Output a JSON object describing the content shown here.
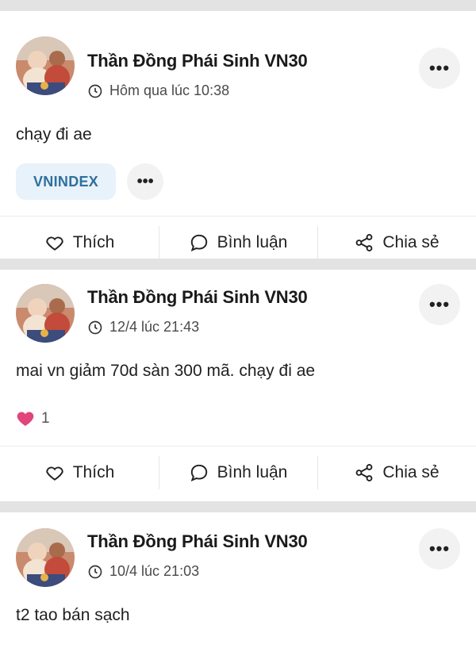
{
  "posts": [
    {
      "author": "Thần Đồng Phái Sinh VN30",
      "time": "Hôm qua lúc 10:38",
      "text": "chạy đi ae",
      "tags": [
        "VNINDEX"
      ],
      "reaction_count": null,
      "actions": {
        "like": "Thích",
        "comment": "Bình luận",
        "share": "Chia sẻ"
      }
    },
    {
      "author": "Thần Đồng Phái Sinh VN30",
      "time": "12/4 lúc 21:43",
      "text": "mai vn giảm 70d sàn 300 mã. chạy đi ae",
      "tags": [],
      "reaction_count": "1",
      "actions": {
        "like": "Thích",
        "comment": "Bình luận",
        "share": "Chia sẻ"
      }
    },
    {
      "author": "Thần Đồng Phái Sinh VN30",
      "time": "10/4 lúc 21:03",
      "text": "t2 tao bán sạch",
      "tags": [],
      "reaction_count": null,
      "actions": null
    }
  ],
  "icons": {
    "more": "more-horizontal-icon",
    "clock": "clock-icon",
    "like": "heart-outline-icon",
    "comment": "comment-bubble-icon",
    "share": "share-icon",
    "reaction": "heart-filled-icon"
  },
  "colors": {
    "tag_bg": "#e8f2fa",
    "tag_text": "#2f6f9f",
    "reaction_heart": "#e0457b",
    "divider": "#e3e3e3"
  }
}
